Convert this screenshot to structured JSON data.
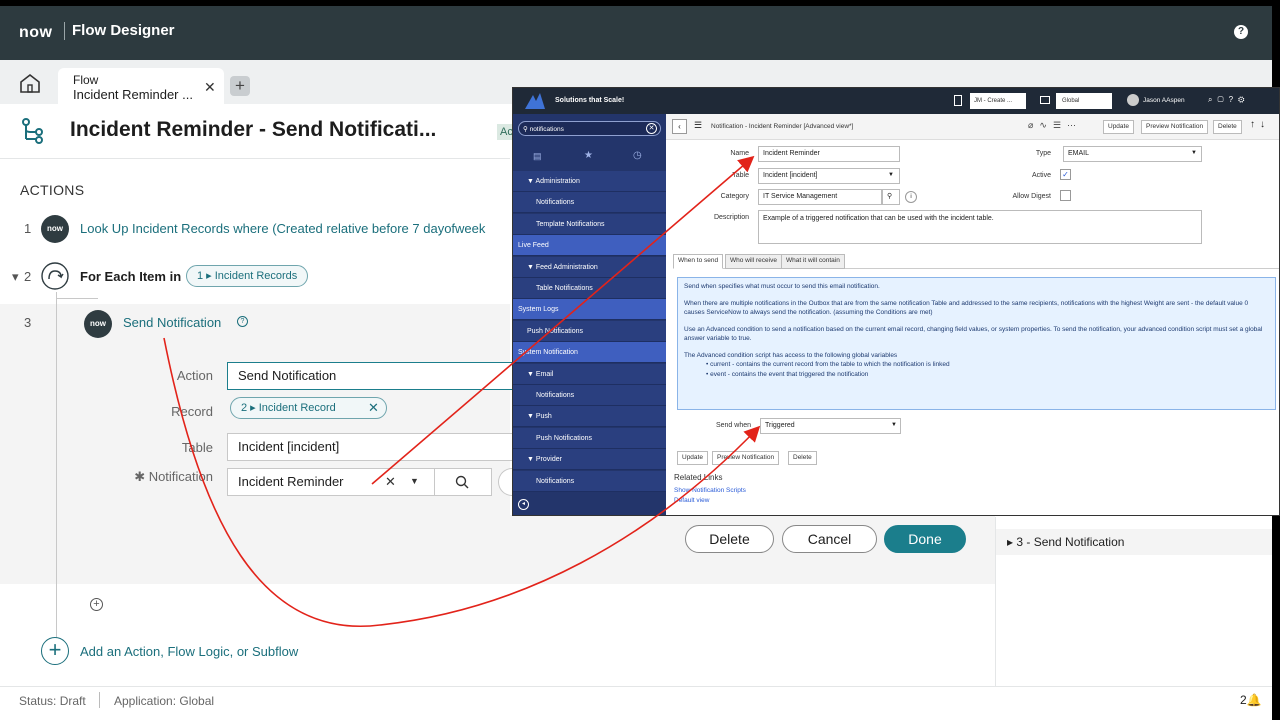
{
  "app": {
    "logo": "now",
    "title": "Flow Designer",
    "help": "?"
  },
  "tab": {
    "line1": "Flow",
    "line2": "Incident Reminder ...",
    "close": "✕",
    "add": "+"
  },
  "header": {
    "title": "Incident Reminder - Send Notificati...",
    "badge": "Ac"
  },
  "actions": {
    "heading": "ACTIONS",
    "rows": [
      {
        "num": "1",
        "icon": "now",
        "text": "Look Up Incident Records where (Created relative before 7 dayofweek"
      },
      {
        "num": "2",
        "text": "For Each Item in",
        "pill": "1 ▸ Incident Records"
      },
      {
        "num": "3",
        "icon": "now",
        "text": "Send Notification"
      }
    ],
    "add_label": "Add an Action, Flow Logic, or Subflow"
  },
  "action_form": {
    "action_label": "Action",
    "action_value": "Send Notification",
    "record_label": "Record",
    "record_pill": "2 ▸ Incident Record",
    "table_label": "Table",
    "table_value": "Incident [incident]",
    "notification_label": "✱ Notification",
    "notification_value": "Incident Reminder",
    "delete": "Delete",
    "cancel": "Cancel",
    "done": "Done"
  },
  "right_panel": {
    "row": "3 - Send Notification"
  },
  "footer": {
    "status": "Status: Draft",
    "application": "Application: Global",
    "count": "2"
  },
  "overlay": {
    "brand": "Solutions that Scale!",
    "update_set": "JM - Create ...",
    "scope": "Global",
    "user": "Jason AAspen",
    "filter": "notifications",
    "nav": [
      {
        "label": "▼ Administration",
        "indent": 1,
        "sel": false
      },
      {
        "label": "Notifications",
        "indent": 2,
        "sel": false
      },
      {
        "label": "Template Notifications",
        "indent": 2,
        "sel": false
      },
      {
        "label": "Live Feed",
        "indent": 0,
        "sel": true
      },
      {
        "label": "▼ Feed Administration",
        "indent": 1,
        "sel": false
      },
      {
        "label": "Table Notifications",
        "indent": 2,
        "sel": false
      },
      {
        "label": "System Logs",
        "indent": 0,
        "sel": true
      },
      {
        "label": "Push Notifications",
        "indent": 1,
        "sel": false
      },
      {
        "label": "System Notification",
        "indent": 0,
        "sel": true
      },
      {
        "label": "▼ Email",
        "indent": 1,
        "sel": false
      },
      {
        "label": "Notifications",
        "indent": 2,
        "sel": false
      },
      {
        "label": "▼ Push",
        "indent": 1,
        "sel": false
      },
      {
        "label": "Push Notifications",
        "indent": 2,
        "sel": false
      },
      {
        "label": "▼ Provider",
        "indent": 1,
        "sel": false
      },
      {
        "label": "Notifications",
        "indent": 2,
        "sel": false
      }
    ],
    "record_title": "Notification - Incident Reminder [Advanced view*]",
    "buttons": [
      "Update",
      "Preview Notification",
      "Delete"
    ],
    "name_label": "Name",
    "name_value": "Incident Reminder",
    "table_label": "Table",
    "table_value": "Incident [incident]",
    "category_label": "Category",
    "category_value": "IT Service Management",
    "description_label": "Description",
    "description_value": "Example of a triggered notification that can be used with the incident table.",
    "type_label": "Type",
    "type_value": "EMAIL",
    "active_label": "Active",
    "allow_digest_label": "Allow Digest",
    "tabs": [
      "When to send",
      "Who will receive",
      "What it will contain"
    ],
    "info_lines": [
      "Send when specifies what must occur to send this email notification.",
      "When there are multiple notifications in the Outbox that are from the same notification Table and addressed to the same recipients, notifications with the highest Weight are sent - the default value 0 causes ServiceNow to always send the notification. (assuming the Conditions are met)",
      "Use an Advanced condition to send a notification based on the current email record, changing field values, or system properties. To send the notification, your advanced condition script must set a global answer variable to true.",
      "The Advanced condition script has access to the following global variables",
      "current - contains the current record from the table to which the notification is linked",
      "event - contains the event that triggered the notification"
    ],
    "send_when_label": "Send when",
    "send_when_value": "Triggered",
    "bottom_buttons": [
      "Update",
      "Preview Notification",
      "Delete"
    ],
    "related_links_title": "Related Links",
    "related_links": [
      "Show Notification Scripts",
      "Default view"
    ]
  },
  "colors": {
    "topbar": "#2d3a3f",
    "accent": "#1b7e8c",
    "arrow": "#e2231a",
    "nav": "#2a3f7f"
  }
}
